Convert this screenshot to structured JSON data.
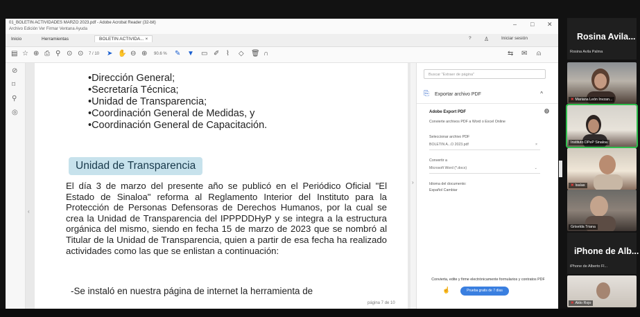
{
  "window": {
    "title": "01_BOLETIN ACTIVIDADES MARZO 2023.pdf - Adobe Acrobat Reader (32-bit)",
    "menu": "Archivo  Edición  Ver  Firmar  Ventana  Ayuda",
    "controls": [
      "–",
      "□",
      "✕"
    ]
  },
  "tabs": {
    "items": [
      "Inicio",
      "Herramientas",
      "BOLETIN ACTIVIDA... ×"
    ],
    "right": [
      "?",
      "Iniciar sesión"
    ]
  },
  "toolbar": {
    "page_indicator": "7 / 10",
    "zoom": "90.6 %"
  },
  "document": {
    "bullets": [
      "•Dirección General;",
      "•Secretaría Técnica;",
      "•Unidad de Transparencia;",
      "•Coordinación General de Medidas, y",
      "•Coordinación General de Capacitación."
    ],
    "heading": "Unidad de Transparencia",
    "paragraph": "El día 3 de marzo del presente año se publicó en el Periódico Oficial \"El Estado de Sinaloa\" reforma al Reglamento Interior del Instituto para la Protección de Personas Defensoras de Derechos Humanos, por la cual se crea la Unidad de Transparencia del IPPPDDHyP y se integra a la estructura orgánica del mismo, siendo en fecha 15 de marzo de 2023 que se nombró al Titular de la Unidad de Transparencia, quien a partir de esa fecha ha realizado actividades como las que se enlistan a continuación:",
    "paragraph2": "-Se instaló en nuestra página de internet la herramienta de",
    "page_label": "página 7 de 10"
  },
  "side_panel": {
    "search_placeholder": "Buscar \"Extraer de página\"",
    "export_title": "Exportar archivo PDF",
    "export_service": "Adobe Export PDF",
    "export_desc": "Convierte archivos PDF a Word o Excel Online",
    "select_label": "Seleccionar archivo PDF",
    "selected_file": "BOLETIN A...O 2023.pdf",
    "convert_label": "Convertir a",
    "convert_value": "Microsoft Word (*.docx)",
    "language_label": "Idioma del documento:",
    "language_value": "Español  Cambiar",
    "promo": "Convierta, edite y firme electrónicamente formularios y contratos PDF",
    "trial_button": "Prueba gratis de 7 días"
  },
  "participants": [
    {
      "big": "Rosina Avila...",
      "sub": "Rosina Avila Palma"
    },
    {
      "label": "Mariana León Invzan..."
    },
    {
      "label": "Instituto DPeP Sinaloa"
    },
    {
      "label": "Isaías"
    },
    {
      "label": "Griselda Triana"
    },
    {
      "big": "iPhone de Alb...",
      "sub": "iPhone de Alberto Fl..."
    },
    {
      "label": "Aldo Rojo"
    }
  ]
}
